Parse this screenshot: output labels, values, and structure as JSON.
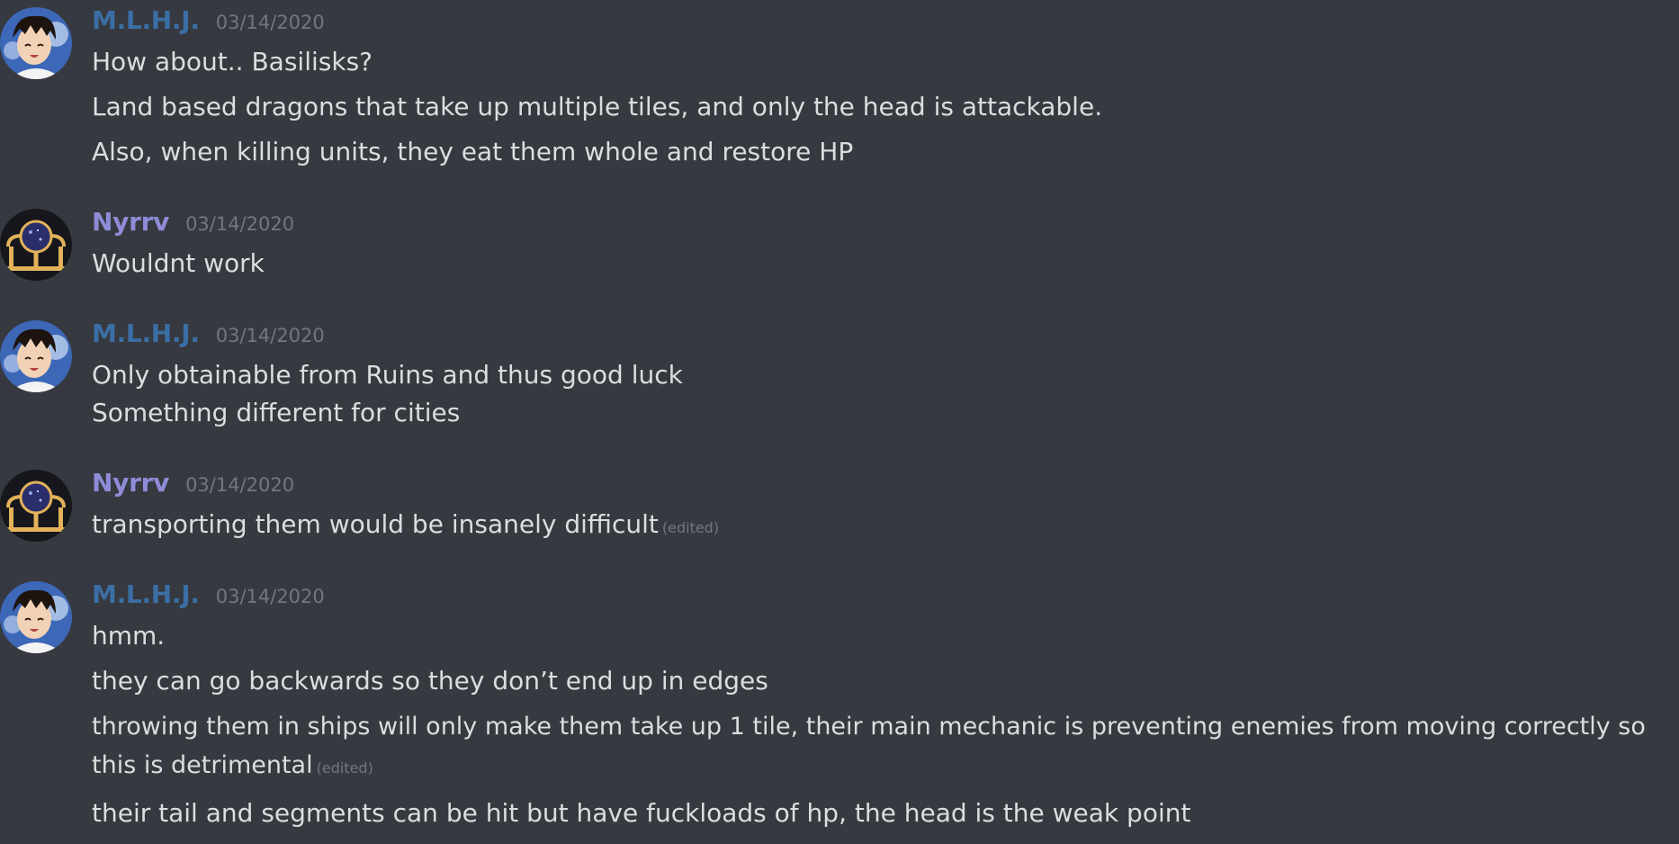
{
  "users": {
    "mlhj": {
      "name": "M.L.H.J.",
      "color": "#3b6ea5"
    },
    "nyrrv": {
      "name": "Nyrrv",
      "color": "#8e8cd8"
    }
  },
  "messages": [
    {
      "author": "M.L.H.J.",
      "timestamp": "03/14/2020",
      "lines": [
        "How about.. Basilisks?",
        "Land based dragons that take up multiple tiles, and only the head is attackable.",
        "Also, when killing units, they eat them whole and restore HP"
      ]
    },
    {
      "author": "Nyrrv",
      "timestamp": "03/14/2020",
      "lines": [
        "Wouldnt work"
      ]
    },
    {
      "author": "M.L.H.J.",
      "timestamp": "03/14/2020",
      "lines": [
        "Only obtainable from Ruins and thus good luck",
        "Something different for cities"
      ]
    },
    {
      "author": "Nyrrv",
      "timestamp": "03/14/2020",
      "lines": [
        "transporting them would be insanely difficult"
      ],
      "edited_label": "(edited)"
    },
    {
      "author": "M.L.H.J.",
      "timestamp": "03/14/2020",
      "lines": [
        "hmm.",
        "they can go backwards so they don’t end up in edges",
        "throwing them in ships will only make them take up 1 tile, their main mechanic is preventing enemies from moving correctly so this is detrimental",
        "their tail and segments can be hit but have fuckloads of hp, the head is the weak point"
      ],
      "edited_label": "(edited)"
    }
  ]
}
